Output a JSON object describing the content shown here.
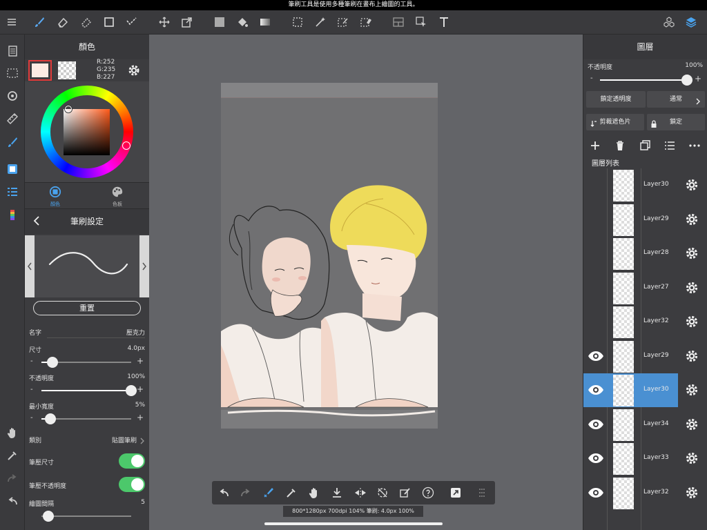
{
  "status_tip": "筆刷工具是使用多種筆刷在畫布上繪圖的工具。",
  "color_panel": {
    "title": "顏色",
    "rgb": {
      "r": "R:252",
      "g": "G:235",
      "b": "B:227"
    },
    "tabs": [
      {
        "label": "顏色"
      },
      {
        "label": "色板"
      }
    ],
    "primary_color": "#fcebe3",
    "accent": "#e13b3b"
  },
  "brush_panel": {
    "title": "筆刷設定",
    "reset_label": "重置",
    "name_label": "名字",
    "name_value": "壓克力",
    "size_label": "尺寸",
    "size_value": "4.0px",
    "size_level": 0.12,
    "opacity_label": "不透明度",
    "opacity_value": "100%",
    "opacity_level": 1.0,
    "min_width_label": "最小寬度",
    "min_width_value": "5%",
    "min_width_level": 0.1,
    "category_label": "類別",
    "category_value": "貼圖筆刷",
    "pressure_size_label": "筆壓尺寸",
    "pressure_opacity_label": "筆壓不透明度",
    "spacing_label": "繪圖間隔",
    "spacing_value": "5"
  },
  "layer_panel": {
    "title": "圖層",
    "opacity_label": "不透明度",
    "opacity_value": "100%",
    "opacity_level": 1.0,
    "lock_alpha_label": "鎖定透明度",
    "blend_label": "通常",
    "clip_label": "剪裁遮色片",
    "lock_label": "鎖定",
    "list_label": "圖層列表",
    "selected_color": "#4a90d2",
    "layers": [
      {
        "name": "Layer30",
        "visible": false,
        "selected": false
      },
      {
        "name": "Layer29",
        "visible": false,
        "selected": false
      },
      {
        "name": "Layer28",
        "visible": false,
        "selected": false
      },
      {
        "name": "Layer27",
        "visible": false,
        "selected": false
      },
      {
        "name": "Layer32",
        "visible": false,
        "selected": false
      },
      {
        "name": "Layer29",
        "visible": true,
        "selected": false
      },
      {
        "name": "Layer30",
        "visible": true,
        "selected": true
      },
      {
        "name": "Layer34",
        "visible": true,
        "selected": false
      },
      {
        "name": "Layer33",
        "visible": true,
        "selected": false
      },
      {
        "name": "Layer32",
        "visible": true,
        "selected": false
      }
    ]
  },
  "canvas_status": "800*1280px 700dpi 104% 筆刷: 4.0px 100%"
}
